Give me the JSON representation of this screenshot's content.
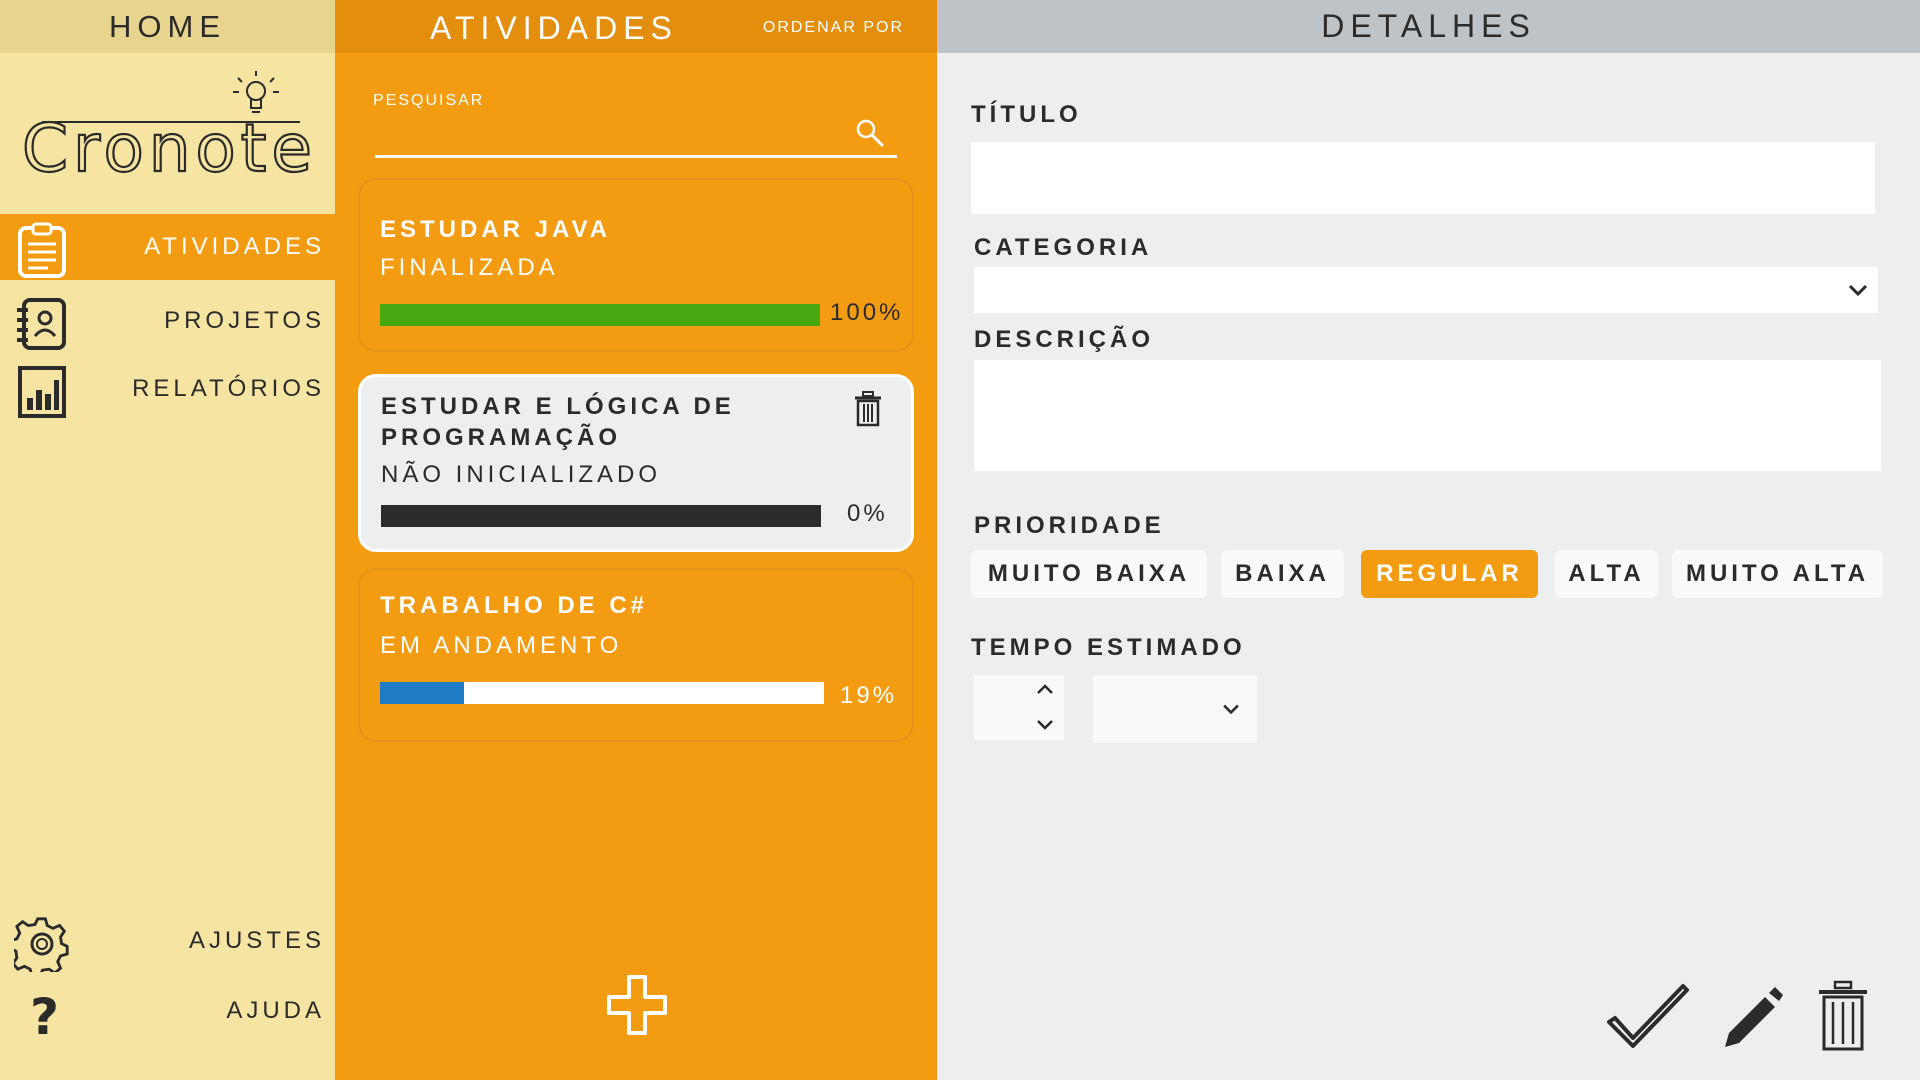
{
  "nav": {
    "header": "HOME",
    "logo_text": "Cronote",
    "items": [
      {
        "label": "ATIVIDADES",
        "icon": "clipboard-icon"
      },
      {
        "label": "PROJETOS",
        "icon": "contacts-book-icon"
      },
      {
        "label": "RELATÓRIOS",
        "icon": "bar-chart-icon"
      }
    ],
    "footer": [
      {
        "label": "AJUSTES",
        "icon": "gear-icon"
      },
      {
        "label": "AJUDA",
        "icon": "question-icon"
      }
    ]
  },
  "activities": {
    "title": "ATIVIDADES",
    "order_by": "ORDENAR POR",
    "search_label": "PESQUISAR",
    "search_value": "",
    "cards": [
      {
        "title": "ESTUDAR JAVA",
        "status": "FINALIZADA",
        "progress": 100,
        "progress_label": "100%",
        "color": "#46A810"
      },
      {
        "title": "ESTUDAR  E LÓGICA DE PROGRAMAÇÃO",
        "status": "NÃO INICIALIZADO",
        "progress": 0,
        "progress_label": "0%",
        "color": "#2B2B2B"
      },
      {
        "title": "TRABALHO DE C#",
        "status": "EM ANDAMENTO",
        "progress": 19,
        "progress_label": "19%",
        "color": "#1E7BC4"
      }
    ]
  },
  "details": {
    "header": "DETALHES",
    "title_label": "TÍTULO",
    "title_value": "",
    "category_label": "CATEGORIA",
    "category_value": "",
    "description_label": "DESCRIÇÃO",
    "description_value": "",
    "priority_label": "PRIORIDADE",
    "priorities": [
      "MUITO BAIXA",
      "BAIXA",
      "REGULAR",
      "ALTA",
      "MUITO ALTA"
    ],
    "priority_selected": "REGULAR",
    "time_label": "TEMPO ESTIMADO",
    "time_value": "",
    "time_unit": ""
  },
  "colors": {
    "accent": "#F39C12",
    "nav_bg": "#F6E4A3",
    "details_bg": "#ECEEEF",
    "text": "#2B2B2B"
  }
}
